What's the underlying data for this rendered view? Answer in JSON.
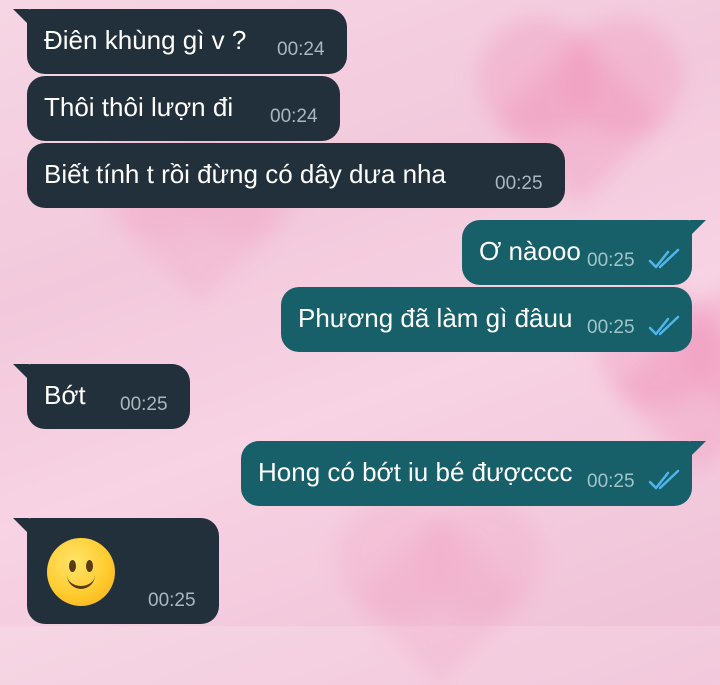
{
  "messages": [
    {
      "text": "Điên khùng gì v ?",
      "time": "00:24",
      "direction": "incoming"
    },
    {
      "text": "Thôi thôi lượn đi",
      "time": "00:24",
      "direction": "incoming"
    },
    {
      "text": "Biết tính t rồi đừng có dây dưa nha",
      "time": "00:25",
      "direction": "incoming"
    },
    {
      "text": "Ơ nàooo",
      "time": "00:25",
      "direction": "outgoing",
      "status": "read"
    },
    {
      "text": "Phương đã làm gì đâuu",
      "time": "00:25",
      "direction": "outgoing",
      "status": "read"
    },
    {
      "text": "Bớt",
      "time": "00:25",
      "direction": "incoming"
    },
    {
      "text": "Hong có bớt iu bé đượcccc",
      "time": "00:25",
      "direction": "outgoing",
      "status": "read"
    },
    {
      "emoji": "slightly-smiling-face-icon",
      "time": "00:25",
      "direction": "incoming"
    }
  ],
  "colors": {
    "incoming_bubble": "#21303a",
    "outgoing_bubble": "#17606a",
    "read_ticks": "#4fb6ec",
    "background": "#f4cfe0"
  }
}
